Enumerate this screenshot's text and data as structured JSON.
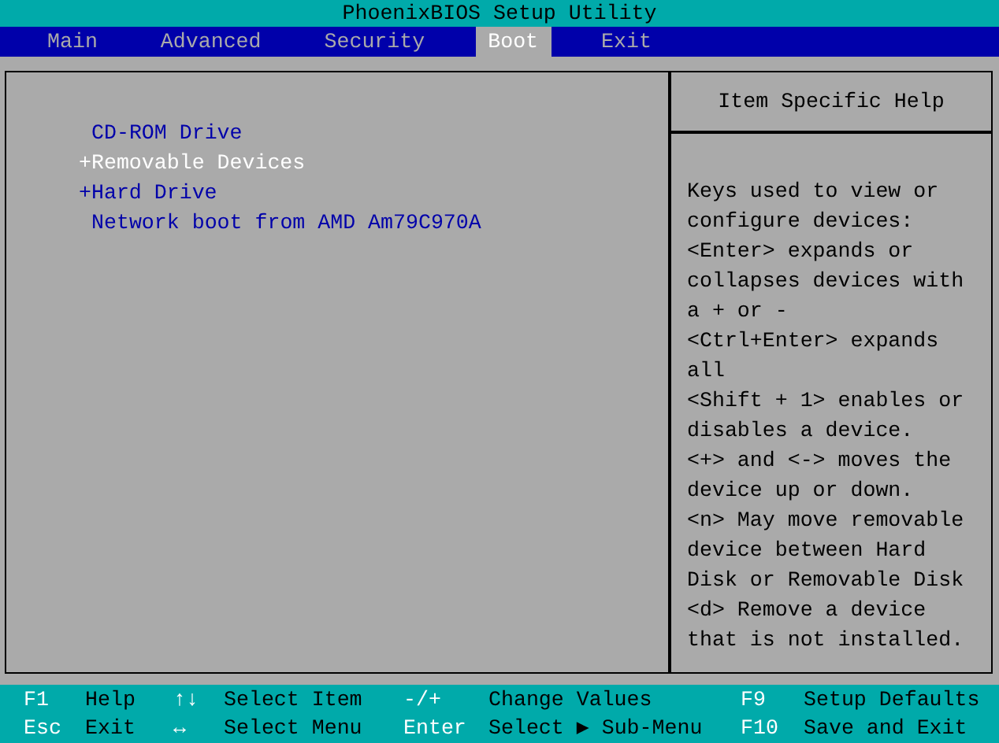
{
  "window": {
    "title": "PhoenixBIOS Setup Utility"
  },
  "tabs": [
    {
      "label": "Main",
      "selected": false
    },
    {
      "label": "Advanced",
      "selected": false
    },
    {
      "label": "Security",
      "selected": false
    },
    {
      "label": "Boot",
      "selected": true
    },
    {
      "label": "Exit",
      "selected": false
    }
  ],
  "boot_items": [
    {
      "label": "CD-ROM Drive",
      "selected": false
    },
    {
      "marker": "+",
      "label": "Removable Devices",
      "selected": true
    },
    {
      "marker": "+",
      "label": "Hard Drive",
      "selected": false
    },
    {
      "label": "Network boot from AMD Am79C970A",
      "selected": false
    }
  ],
  "help": {
    "title": "Item Specific Help",
    "lines": [
      "Keys used to view or",
      "configure devices:",
      "<Enter> expands or",
      "collapses devices with",
      "a + or -",
      "<Ctrl+Enter> expands",
      "all",
      "<Shift + 1> enables or",
      "disables a device.",
      "<+> and <-> moves the",
      "device up or down.",
      "<n> May move removable",
      "device between Hard",
      "Disk or Removable Disk",
      "<d> Remove a device",
      "that is not installed."
    ]
  },
  "status_bar": [
    [
      {
        "key": "F1",
        "action": "Help"
      },
      {
        "key": "↑↓",
        "action": "Select Item"
      },
      {
        "key": "-/+",
        "action": "Change Values"
      },
      {
        "key": "F9",
        "action": "Setup Defaults"
      }
    ],
    [
      {
        "key": "Esc",
        "action": "Exit"
      },
      {
        "key": "↔",
        "action": "Select Menu"
      },
      {
        "key": "Enter",
        "action": "Select ▶ Sub-Menu"
      },
      {
        "key": "F10",
        "action": "Save and Exit"
      }
    ]
  ]
}
